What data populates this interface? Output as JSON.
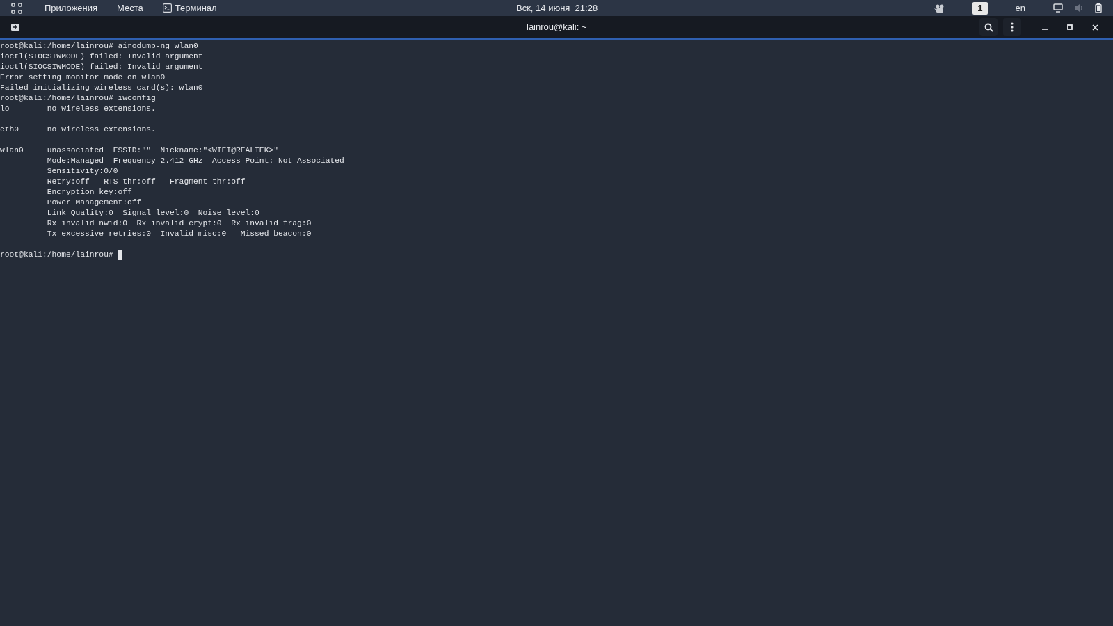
{
  "top_bar": {
    "menus": [
      "Приложения",
      "Места"
    ],
    "app_menu": "Терминал",
    "clock": "Вск, 14 июня  21:28",
    "workspace": "1",
    "keyboard_layout": "en"
  },
  "window": {
    "title": "lainrou@kali: ~"
  },
  "terminal": {
    "blocks": [
      {
        "lines": [
          "root@kali:/home/lainrou# airodump-ng wlan0",
          "ioctl(SIOCSIWMODE) failed: Invalid argument",
          "ioctl(SIOCSIWMODE) failed: Invalid argument",
          "Error setting monitor mode on wlan0",
          "Failed initializing wireless card(s): wlan0",
          "root@kali:/home/lainrou# iwconfig",
          "lo        no wireless extensions."
        ]
      },
      {
        "lines": [
          "eth0      no wireless extensions."
        ]
      },
      {
        "lines": [
          "wlan0     unassociated  ESSID:\"\"  Nickname:\"<WIFI@REALTEK>\"",
          "          Mode:Managed  Frequency=2.412 GHz  Access Point: Not-Associated",
          "          Sensitivity:0/0",
          "          Retry:off   RTS thr:off   Fragment thr:off",
          "          Encryption key:off",
          "          Power Management:off",
          "          Link Quality:0  Signal level:0  Noise level:0",
          "          Rx invalid nwid:0  Rx invalid crypt:0  Rx invalid frag:0",
          "          Tx excessive retries:0  Invalid misc:0   Missed beacon:0"
        ]
      }
    ],
    "prompt": "root@kali:/home/lainrou# "
  }
}
